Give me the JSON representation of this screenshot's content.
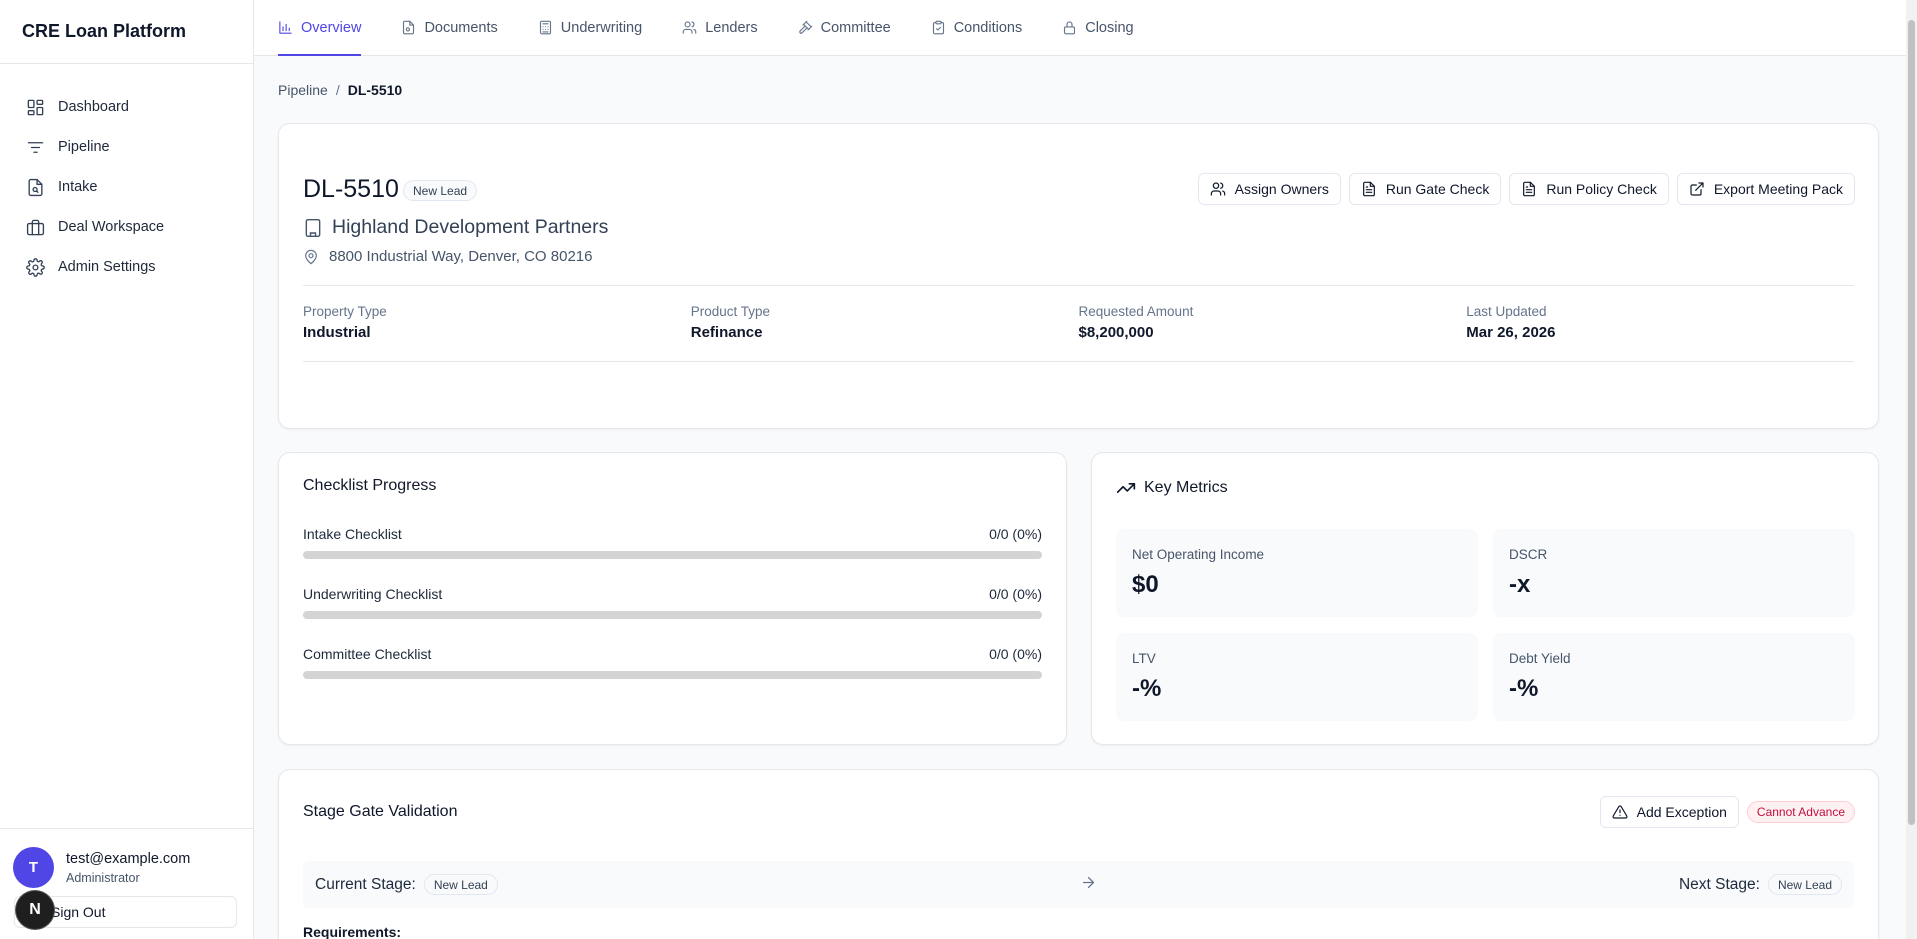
{
  "app": {
    "title": "CRE Loan Platform"
  },
  "sidebar": {
    "items": [
      {
        "label": "Dashboard",
        "icon": "dashboard-icon"
      },
      {
        "label": "Pipeline",
        "icon": "filter-lines-icon"
      },
      {
        "label": "Intake",
        "icon": "file-search-icon"
      },
      {
        "label": "Deal Workspace",
        "icon": "briefcase-icon"
      },
      {
        "label": "Admin Settings",
        "icon": "gear-icon"
      }
    ],
    "user": {
      "initial": "T",
      "email": "test@example.com",
      "role": "Administrator",
      "sign_out": "Sign Out"
    },
    "dev_badge": "N"
  },
  "tabs": [
    {
      "label": "Overview",
      "active": true
    },
    {
      "label": "Documents"
    },
    {
      "label": "Underwriting"
    },
    {
      "label": "Lenders"
    },
    {
      "label": "Committee"
    },
    {
      "label": "Conditions"
    },
    {
      "label": "Closing"
    }
  ],
  "breadcrumb": {
    "parent": "Pipeline",
    "separator": "/",
    "current": "DL-5510"
  },
  "deal": {
    "id": "DL-5510",
    "status": "New Lead",
    "company": "Highland Development Partners",
    "address": "8800 Industrial Way, Denver, CO 80216",
    "actions": {
      "assign_owners": "Assign Owners",
      "run_gate_check": "Run Gate Check",
      "run_policy_check": "Run Policy Check",
      "export_meeting_pack": "Export Meeting Pack"
    },
    "info": [
      {
        "label": "Property Type",
        "value": "Industrial"
      },
      {
        "label": "Product Type",
        "value": "Refinance"
      },
      {
        "label": "Requested Amount",
        "value": "$8,200,000"
      },
      {
        "label": "Last Updated",
        "value": "Mar 26, 2026"
      }
    ]
  },
  "checklist": {
    "title": "Checklist Progress",
    "items": [
      {
        "label": "Intake Checklist",
        "value": "0/0 (0%)",
        "progress": 0
      },
      {
        "label": "Underwriting Checklist",
        "value": "0/0 (0%)",
        "progress": 0
      },
      {
        "label": "Committee Checklist",
        "value": "0/0 (0%)",
        "progress": 0
      }
    ]
  },
  "metrics": {
    "title": "Key Metrics",
    "items": [
      {
        "label": "Net Operating Income",
        "value": "$0"
      },
      {
        "label": "DSCR",
        "value": "-x"
      },
      {
        "label": "LTV",
        "value": "-%"
      },
      {
        "label": "Debt Yield",
        "value": "-%"
      }
    ]
  },
  "gate": {
    "title": "Stage Gate Validation",
    "add_exception": "Add Exception",
    "status": "Cannot Advance",
    "current_stage_label": "Current Stage:",
    "current_stage": "New Lead",
    "next_stage_label": "Next Stage:",
    "next_stage": "New Lead",
    "requirements_label": "Requirements:"
  },
  "colors": {
    "accent": "#4f46e5",
    "danger": "#be123c"
  }
}
